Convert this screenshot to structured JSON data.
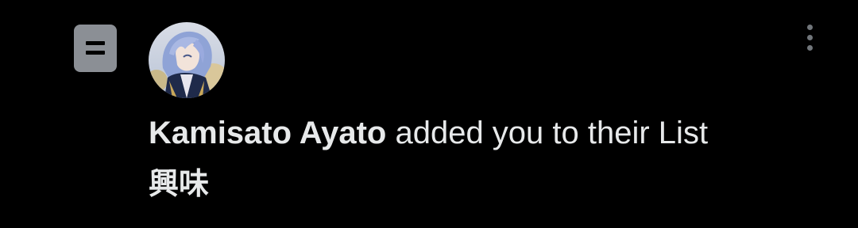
{
  "notification": {
    "type_icon": "list-icon",
    "avatar_icon": "user-avatar-anime-character",
    "menu_icon": "more-vertical-icon",
    "user_name": "Kamisato Ayato",
    "action_text": " added you to their List",
    "list_name": "興味"
  },
  "colors": {
    "background": "#000000",
    "text": "#e7e9ea",
    "icon_gray": "#8b8f95",
    "menu_dots": "#71767b"
  }
}
